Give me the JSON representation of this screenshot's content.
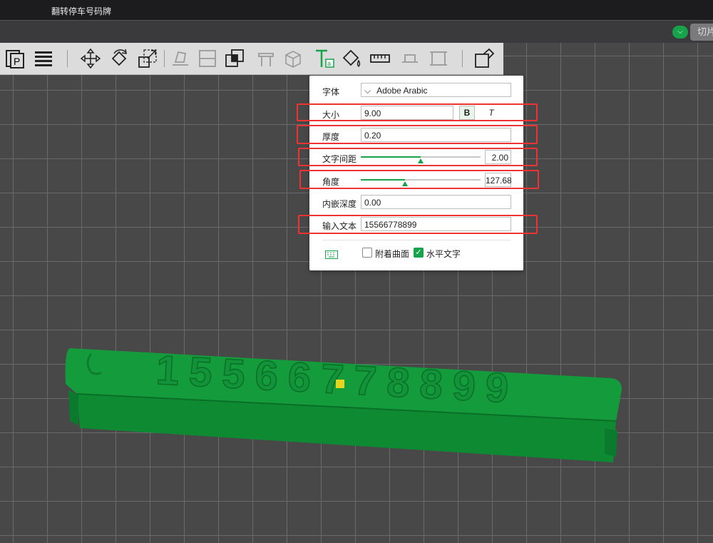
{
  "window": {
    "title": "翻转停车号码牌"
  },
  "menubar": {
    "toggle_icon": "chevron-down-icon",
    "slice_label": "切片"
  },
  "toolbar": {
    "buttons": [
      "copy-page-icon",
      "layers-icon",
      "move-icon",
      "rotate-icon",
      "scale-icon",
      "lay-flat-icon",
      "split-icon",
      "boolean-icon",
      "support-icon",
      "cube-icon",
      "text-tool-icon",
      "paint-icon",
      "measure-icon",
      "cut-icon",
      "face-select-icon",
      "arrange-icon"
    ]
  },
  "text_panel": {
    "font": {
      "label": "字体",
      "value": "Adobe Arabic"
    },
    "size": {
      "label": "大小",
      "value": "9.00",
      "bold_label": "B",
      "italic_label": "T"
    },
    "thickness": {
      "label": "厚度",
      "value": "0.20"
    },
    "spacing": {
      "label": "文字间距",
      "value": "2.00",
      "level": 0.5
    },
    "angle": {
      "label": "角度",
      "value": "127.68",
      "level": 0.37
    },
    "embed_depth": {
      "label": "内嵌深度",
      "value": "0.00"
    },
    "input_text": {
      "label": "输入文本",
      "value": "15566778899"
    },
    "attach_surface": {
      "label": "附着曲面",
      "checked": false
    },
    "horizontal_text": {
      "label": "水平文字",
      "checked": true
    }
  },
  "model": {
    "text": "15566778899",
    "color": "#16a34a"
  }
}
